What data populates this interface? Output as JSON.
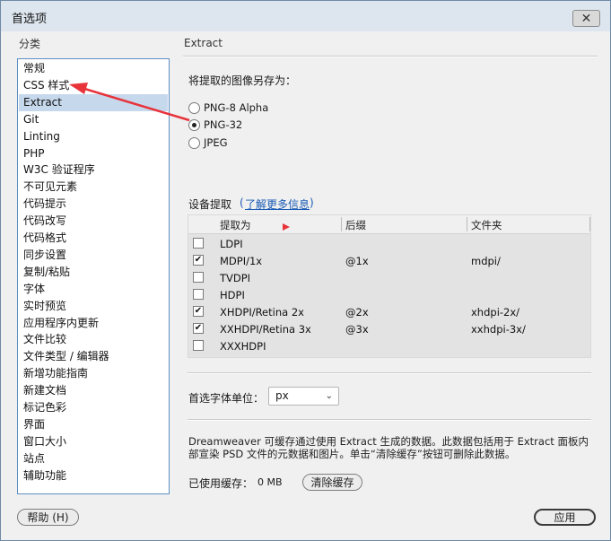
{
  "window": {
    "title": "首选项",
    "close_label": "✕"
  },
  "sidebar": {
    "heading": "分类",
    "items": [
      {
        "label": "常规"
      },
      {
        "label": "CSS 样式"
      },
      {
        "label": "Extract"
      },
      {
        "label": "Git"
      },
      {
        "label": "Linting"
      },
      {
        "label": "PHP"
      },
      {
        "label": "W3C 验证程序"
      },
      {
        "label": "不可见元素"
      },
      {
        "label": "代码提示"
      },
      {
        "label": "代码改写"
      },
      {
        "label": "代码格式"
      },
      {
        "label": "同步设置"
      },
      {
        "label": "复制/粘贴"
      },
      {
        "label": "字体"
      },
      {
        "label": "实时预览"
      },
      {
        "label": "应用程序内更新"
      },
      {
        "label": "文件比较"
      },
      {
        "label": "文件类型 / 编辑器"
      },
      {
        "label": "新增功能指南"
      },
      {
        "label": "新建文档"
      },
      {
        "label": "标记色彩"
      },
      {
        "label": "界面"
      },
      {
        "label": "窗口大小"
      },
      {
        "label": "站点"
      },
      {
        "label": "辅助功能"
      }
    ],
    "selected_index": 2
  },
  "panel": {
    "title": "Extract",
    "save_as_label": "将提取的图像另存为：",
    "formats": [
      {
        "label": "PNG-8 Alpha",
        "checked": false
      },
      {
        "label": "PNG-32",
        "checked": true
      },
      {
        "label": "JPEG",
        "checked": false
      }
    ],
    "device_label": "设备提取",
    "learn_more": "了解更多信息",
    "table": {
      "headers": [
        "提取为",
        "后缀",
        "文件夹"
      ],
      "rows": [
        {
          "name": "LDPI",
          "suffix": "",
          "folder": "",
          "checked": false
        },
        {
          "name": "MDPI/1x",
          "suffix": "@1x",
          "folder": "mdpi/",
          "checked": true
        },
        {
          "name": "TVDPI",
          "suffix": "",
          "folder": "",
          "checked": false
        },
        {
          "name": "HDPI",
          "suffix": "",
          "folder": "",
          "checked": false
        },
        {
          "name": "XHDPI/Retina 2x",
          "suffix": "@2x",
          "folder": "xhdpi-2x/",
          "checked": true
        },
        {
          "name": "XXHDPI/Retina 3x",
          "suffix": "@3x",
          "folder": "xxhdpi-3x/",
          "checked": true
        },
        {
          "name": "XXXHDPI",
          "suffix": "",
          "folder": "",
          "checked": false
        }
      ]
    },
    "font_unit_label": "首选字体单位：",
    "font_unit_value": "px",
    "description": "Dreamweaver 可缓存通过使用 Extract 生成的数据。此数据包括用于 Extract 面板内部宣染 PSD 文件的元数据和图片。单击“清除缓存”按钮可删除此数据。",
    "cache_used_label": "已使用缓存：",
    "cache_used_value": "0 MB",
    "clear_cache_label": "清除缓存"
  },
  "footer": {
    "help_label": "帮助 (H)",
    "apply_label": "应用"
  },
  "colors": {
    "accent_blue": "#5d8fc4",
    "selection": "#c6d8ec",
    "annotation_red": "#e8333b",
    "link": "#1a5bb4"
  }
}
